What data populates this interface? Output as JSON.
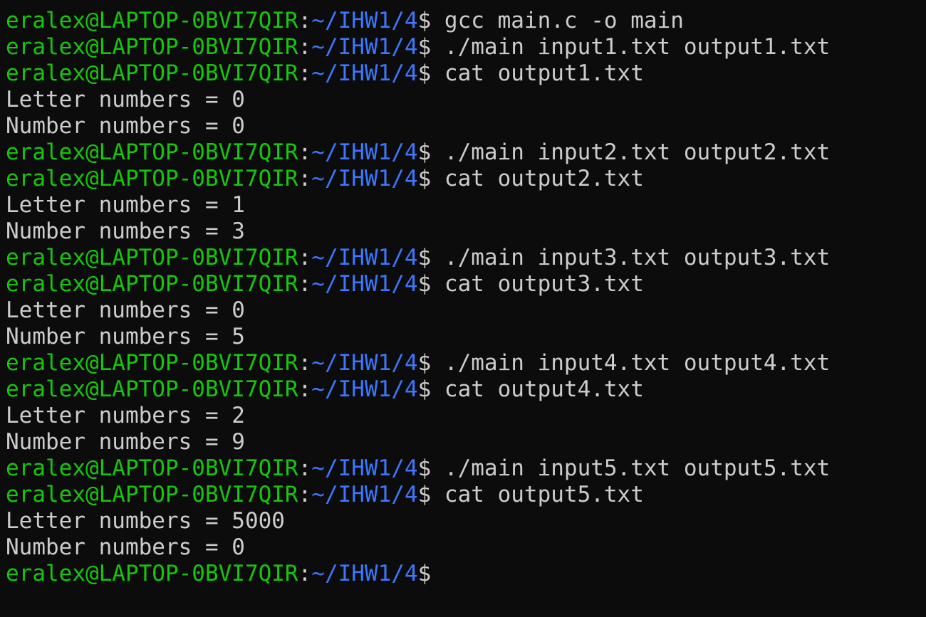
{
  "terminal": {
    "prompt": {
      "user_host": "eralex@LAPTOP-0BVI7QIR",
      "separator": ":",
      "path": "~/IHW1/4",
      "symbol": "$"
    },
    "lines": [
      {
        "type": "prompt",
        "command": "gcc main.c -o main"
      },
      {
        "type": "prompt",
        "command": "./main input1.txt output1.txt"
      },
      {
        "type": "prompt",
        "command": "cat output1.txt"
      },
      {
        "type": "output",
        "text": "Letter numbers = 0"
      },
      {
        "type": "output",
        "text": "Number numbers = 0"
      },
      {
        "type": "prompt",
        "command": "./main input2.txt output2.txt"
      },
      {
        "type": "prompt",
        "command": "cat output2.txt"
      },
      {
        "type": "output",
        "text": "Letter numbers = 1"
      },
      {
        "type": "output",
        "text": "Number numbers = 3"
      },
      {
        "type": "prompt",
        "command": "./main input3.txt output3.txt"
      },
      {
        "type": "prompt",
        "command": "cat output3.txt"
      },
      {
        "type": "output",
        "text": "Letter numbers = 0"
      },
      {
        "type": "output",
        "text": "Number numbers = 5"
      },
      {
        "type": "prompt",
        "command": "./main input4.txt output4.txt"
      },
      {
        "type": "prompt",
        "command": "cat output4.txt"
      },
      {
        "type": "output",
        "text": "Letter numbers = 2"
      },
      {
        "type": "output",
        "text": "Number numbers = 9"
      },
      {
        "type": "prompt",
        "command": "./main input5.txt output5.txt"
      },
      {
        "type": "prompt",
        "command": "cat output5.txt"
      },
      {
        "type": "output",
        "text": "Letter numbers = 5000"
      },
      {
        "type": "output",
        "text": "Number numbers = 0"
      },
      {
        "type": "prompt",
        "command": ""
      }
    ]
  },
  "colors": {
    "background": "#0c0c0c",
    "foreground": "#cccccc",
    "user_host": "#16c60c",
    "path": "#3b78ff"
  }
}
